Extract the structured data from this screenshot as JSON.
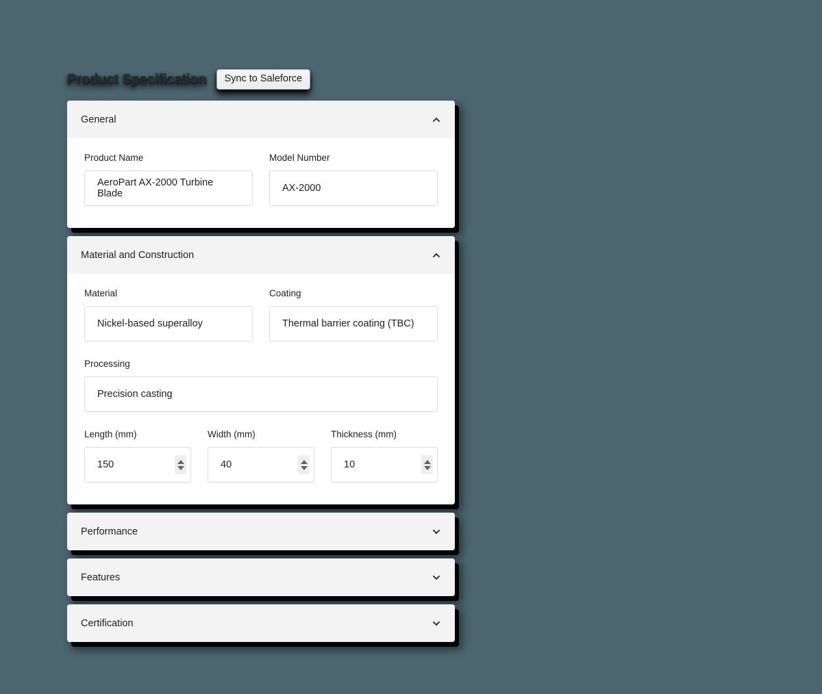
{
  "page": {
    "title": "Product Specification",
    "background_color": "#4c6670"
  },
  "toolbar": {
    "sync_button_label": "Sync to Saleforce"
  },
  "icons": {
    "chevron_up": "chevron-up-icon",
    "chevron_down": "chevron-down-icon",
    "spinner_up": "spinner-up-arrow-icon",
    "spinner_down": "spinner-down-arrow-icon"
  },
  "sections": {
    "general": {
      "title": "General",
      "expanded": true,
      "chevron": "chevron-up",
      "fields": {
        "product_name": {
          "label": "Product Name",
          "value": "AeroPart AX-2000 Turbine Blade"
        },
        "model_number": {
          "label": "Model Number",
          "value": "AX-2000"
        }
      }
    },
    "material": {
      "title": "Material and Construction",
      "expanded": true,
      "chevron": "chevron-up",
      "fields": {
        "material": {
          "label": "Material",
          "value": "Nickel-based superalloy"
        },
        "coating": {
          "label": "Coating",
          "value": "Thermal barrier coating (TBC)"
        },
        "processing": {
          "label": "Processing",
          "value": "Precision casting"
        },
        "length": {
          "label": "Length (mm)",
          "value": "150"
        },
        "width": {
          "label": "Width (mm)",
          "value": "40"
        },
        "thickness": {
          "label": "Thickness (mm)",
          "value": "10"
        }
      }
    },
    "performance": {
      "title": "Performance",
      "expanded": false,
      "chevron": "chevron-down"
    },
    "features": {
      "title": "Features",
      "expanded": false,
      "chevron": "chevron-down"
    },
    "certification": {
      "title": "Certification",
      "expanded": false,
      "chevron": "chevron-down"
    }
  }
}
